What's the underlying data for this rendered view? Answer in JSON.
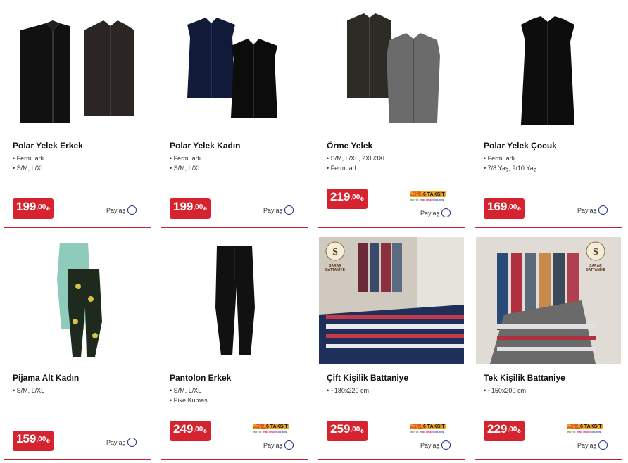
{
  "products": [
    {
      "title": "Polar Yelek Erkek",
      "features": [
        "Fermuarlı",
        "S/M, L/XL"
      ],
      "price_int": "199",
      "price_dec": ",00",
      "currency": "₺",
      "share": "Paylaş",
      "taksit": false,
      "image": "vest-pair-black-brown"
    },
    {
      "title": "Polar Yelek Kadın",
      "features": [
        "Fermuarlı",
        "S/M, L/XL"
      ],
      "price_int": "199",
      "price_dec": ",00",
      "currency": "₺",
      "share": "Paylaş",
      "taksit": false,
      "image": "vest-pair-navy-black"
    },
    {
      "title": "Örme Yelek",
      "features": [
        "S/M, L/XL, 2XL/3XL",
        "Fermuarl"
      ],
      "price_int": "219",
      "price_dec": ",00",
      "currency": "₺",
      "share": "Paylaş",
      "taksit": true,
      "image": "knit-vest-pair"
    },
    {
      "title": "Polar Yelek Çocuk",
      "features": [
        "Fermuarlı",
        "7/8 Yaş, 9/10 Yaş"
      ],
      "price_int": "169",
      "price_dec": ",00",
      "currency": "₺",
      "share": "Paylaş",
      "taksit": false,
      "image": "vest-single-black"
    },
    {
      "title": "Pijama Alt Kadın",
      "features": [
        "S/M, L/XL"
      ],
      "price_int": "159",
      "price_dec": ",00",
      "currency": "₺",
      "share": "Paylaş",
      "taksit": false,
      "image": "pajama-pants-pair"
    },
    {
      "title": "Pantolon Erkek",
      "features": [
        "S/M, L/XL",
        "Pike Kumaş"
      ],
      "price_int": "249",
      "price_dec": ",00",
      "currency": "₺",
      "share": "Paylaş",
      "taksit": true,
      "image": "pants-black"
    },
    {
      "title": "Çift Kişilik Battaniye",
      "features": [
        "~180x220 cm"
      ],
      "price_int": "259",
      "price_dec": ",00",
      "currency": "₺",
      "share": "Paylaş",
      "taksit": true,
      "image": "blanket-double-bed"
    },
    {
      "title": "Tek Kişilik Battaniye",
      "features": [
        "~150x200 cm"
      ],
      "price_int": "229",
      "price_dec": ",00",
      "currency": "₺",
      "share": "Paylaş",
      "taksit": true,
      "image": "blanket-single-hanging"
    }
  ],
  "taksit_badge": {
    "left": "PEŞİN FİYATINA",
    "right": "6 TAKSİT",
    "logos": [
      "world",
      "maximum",
      "bonus"
    ]
  },
  "blanket_brand": {
    "line1": "SARAR",
    "line2": "BATTANİYE",
    "letter": "S"
  },
  "colors": {
    "accent": "#d5242f",
    "border": "#c8242e",
    "share_circle": "#1a2d7c",
    "taksit": "#f2a21b"
  }
}
